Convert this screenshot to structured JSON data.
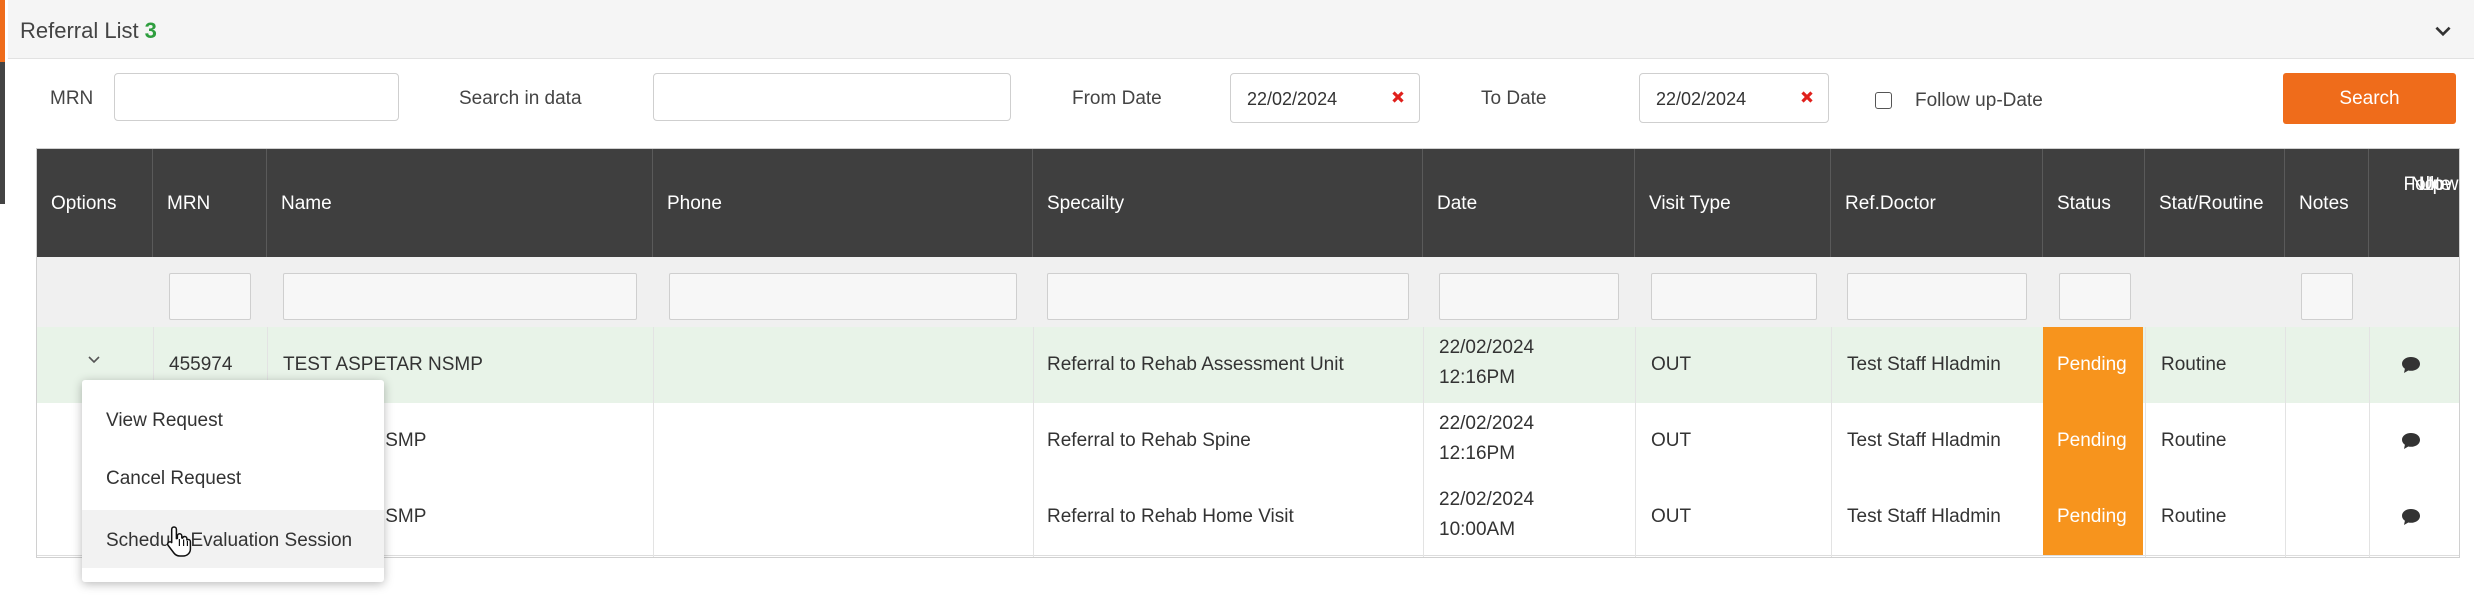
{
  "panel": {
    "title": "Referral List",
    "count": "3"
  },
  "filters": {
    "mrn_label": "MRN",
    "search_label": "Search in data",
    "from_date_label": "From Date",
    "from_date_value": "22/02/2024",
    "to_date_label": "To Date",
    "to_date_value": "22/02/2024",
    "followup_label": "Follow up-Date",
    "search_button": "Search"
  },
  "table": {
    "headers": [
      "Options",
      "MRN",
      "Name",
      "Phone",
      "Specailty",
      "Date",
      "Visit Type",
      "Ref.Doctor",
      "Status",
      "Stat/Routine",
      "Notes"
    ],
    "followup_header": [
      "Follow",
      "Up",
      "Note"
    ],
    "rows": [
      {
        "mrn": "455974",
        "name": "TEST ASPETAR NSMP",
        "phone": "",
        "specialty": "Referral to Rehab Assessment Unit",
        "date": "22/02/2024",
        "time": "12:16PM",
        "visit_type": "OUT",
        "ref_doctor": "Test Staff Hladmin",
        "status": "Pending",
        "stat_routine": "Routine"
      },
      {
        "mrn": "",
        "name": "ETAR NSMP",
        "phone": "",
        "specialty": "Referral to Rehab Spine",
        "date": "22/02/2024",
        "time": "12:16PM",
        "visit_type": "OUT",
        "ref_doctor": "Test Staff Hladmin",
        "status": "Pending",
        "stat_routine": "Routine"
      },
      {
        "mrn": "",
        "name": "ETAR NSMP",
        "phone": "",
        "specialty": "Referral to Rehab Home Visit",
        "date": "22/02/2024",
        "time": "10:00AM",
        "visit_type": "OUT",
        "ref_doctor": "Test Staff Hladmin",
        "status": "Pending",
        "stat_routine": "Routine"
      }
    ]
  },
  "options_menu": {
    "items": [
      "View Request",
      "Cancel Request",
      "Schedule Evaluation Session"
    ]
  },
  "colors": {
    "accent": "#ef6c1b",
    "pending": "#f7941d",
    "header": "#3f3f3f",
    "count": "#2e9e3e"
  },
  "icons": {
    "collapse": "chevron-down-icon",
    "clear": "close-icon",
    "note": "comment-icon",
    "cursor": "hand-pointer-icon"
  }
}
